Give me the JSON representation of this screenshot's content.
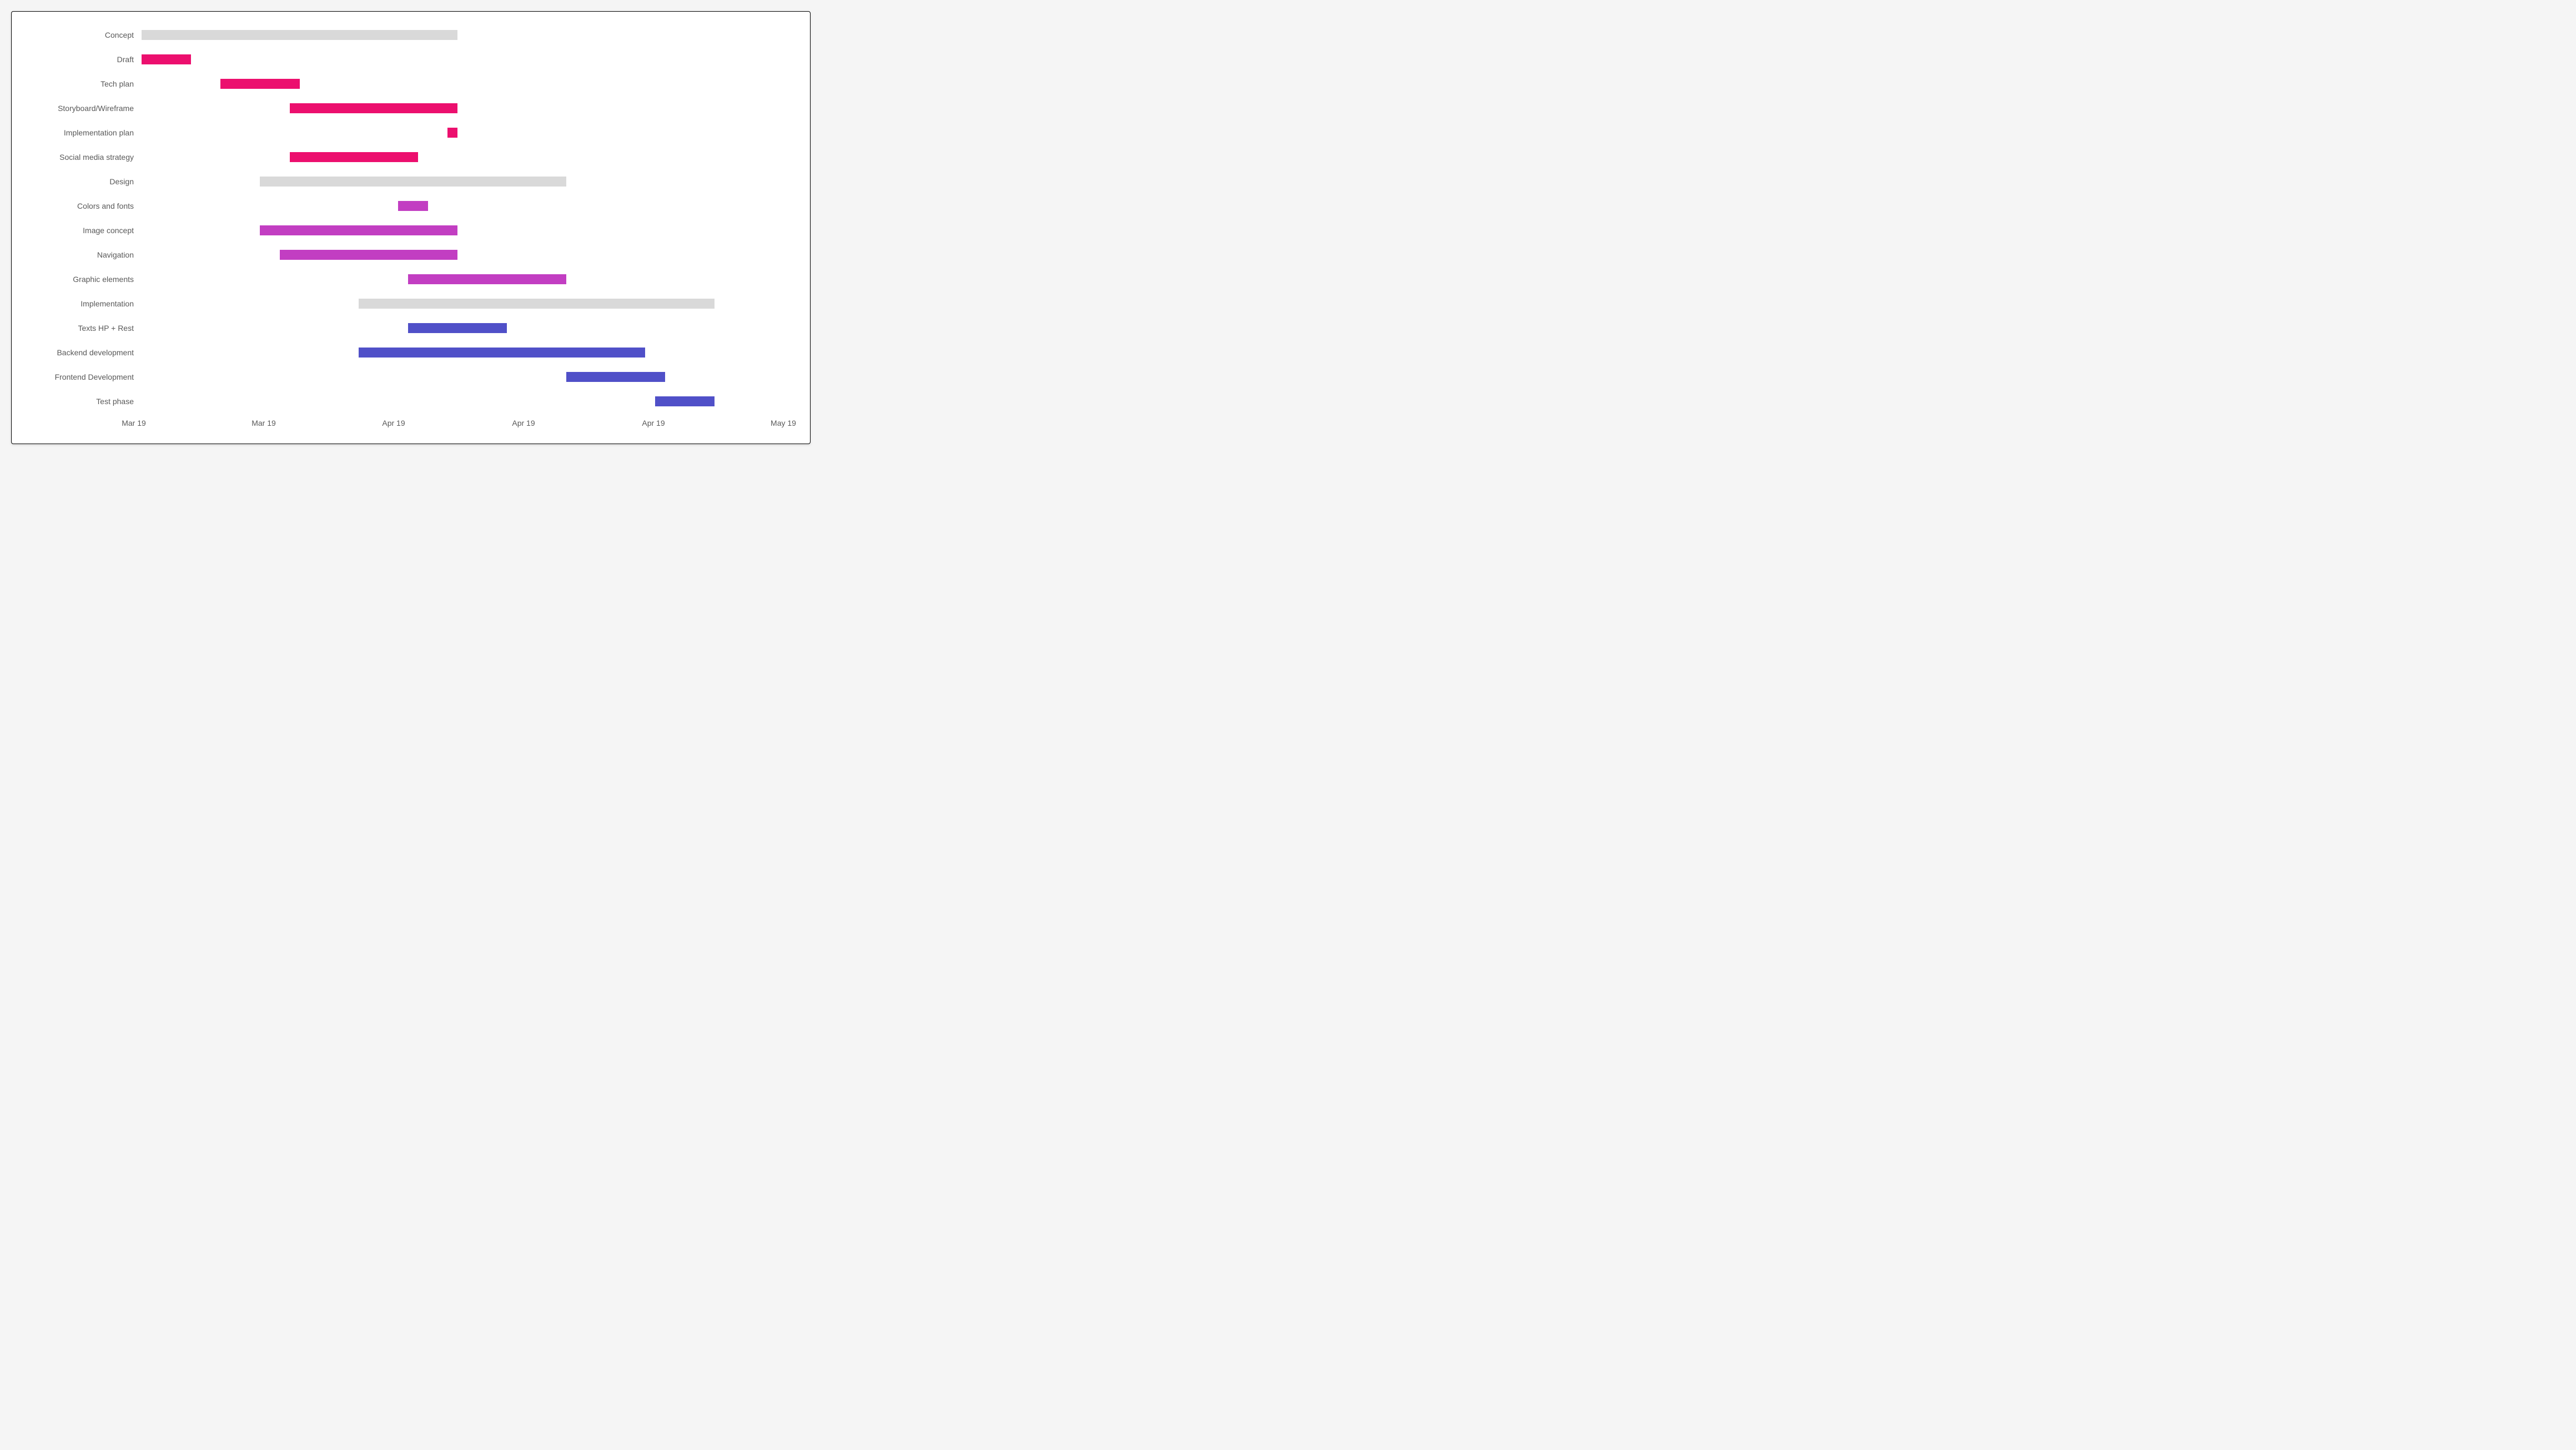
{
  "chart_data": {
    "type": "bar",
    "orientation": "horizontal-gantt",
    "x_domain_days": 66,
    "colors": {
      "group": "#d9d9d9",
      "pink": "#ec0f6e",
      "purple": "#c23ec2",
      "blue": "#5050c8"
    },
    "tasks": [
      {
        "name": "Concept",
        "start": 0,
        "end": 32,
        "color": "group"
      },
      {
        "name": "Draft",
        "start": 0,
        "end": 5,
        "color": "pink"
      },
      {
        "name": "Tech plan",
        "start": 8,
        "end": 16,
        "color": "pink"
      },
      {
        "name": "Storyboard/Wireframe",
        "start": 15,
        "end": 32,
        "color": "pink"
      },
      {
        "name": "Implementation plan",
        "start": 31,
        "end": 32,
        "color": "pink"
      },
      {
        "name": "Social media strategy",
        "start": 15,
        "end": 28,
        "color": "pink"
      },
      {
        "name": "Design",
        "start": 12,
        "end": 43,
        "color": "group"
      },
      {
        "name": "Colors and fonts",
        "start": 26,
        "end": 29,
        "color": "purple"
      },
      {
        "name": "Image concept",
        "start": 12,
        "end": 32,
        "color": "purple"
      },
      {
        "name": "Navigation",
        "start": 14,
        "end": 32,
        "color": "purple"
      },
      {
        "name": "Graphic elements",
        "start": 27,
        "end": 43,
        "color": "purple"
      },
      {
        "name": "Implementation",
        "start": 22,
        "end": 58,
        "color": "group"
      },
      {
        "name": "Texts HP + Rest",
        "start": 27,
        "end": 37,
        "color": "blue"
      },
      {
        "name": "Backend development",
        "start": 22,
        "end": 51,
        "color": "blue"
      },
      {
        "name": "Frontend Development",
        "start": 43,
        "end": 53,
        "color": "blue"
      },
      {
        "name": "Test phase",
        "start": 52,
        "end": 58,
        "color": "blue"
      }
    ],
    "x_ticks": [
      {
        "label": "Mar 19",
        "pos": 0
      },
      {
        "label": "Mar 19",
        "pos": 13
      },
      {
        "label": "Apr 19",
        "pos": 26
      },
      {
        "label": "Apr 19",
        "pos": 39
      },
      {
        "label": "Apr 19",
        "pos": 52
      },
      {
        "label": "May 19",
        "pos": 65
      }
    ]
  }
}
